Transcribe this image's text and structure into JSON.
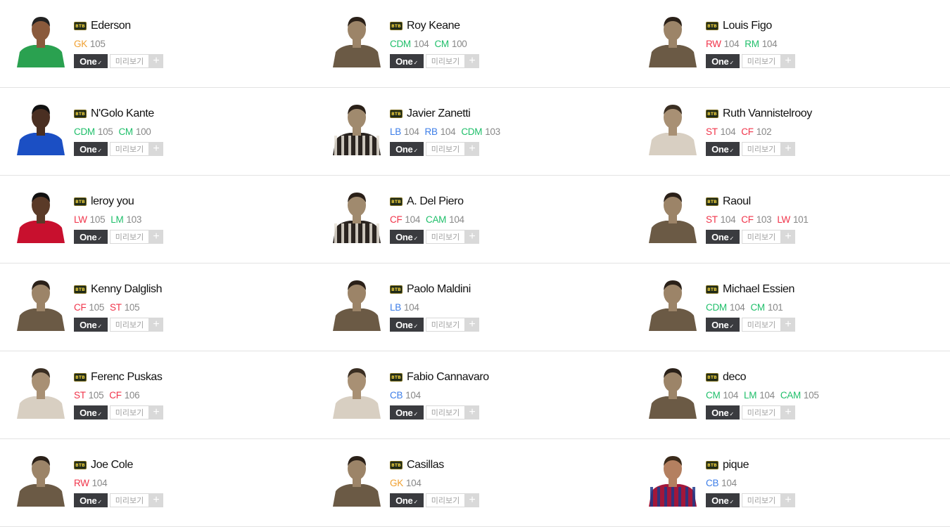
{
  "colors": {
    "GK": "#f0a030",
    "CDM": "#1fbf6a",
    "CM": "#1fbf6a",
    "LM": "#1fbf6a",
    "RM": "#1fbf6a",
    "CAM": "#1fbf6a",
    "RW": "#f0344a",
    "LW": "#f0344a",
    "ST": "#f0344a",
    "CF": "#f0344a",
    "LB": "#3d7ee8",
    "RB": "#3d7ee8",
    "CB": "#3d7ee8"
  },
  "labels": {
    "one": "One",
    "preview": "미리보기",
    "plus": "+"
  },
  "season_badge": "BTB",
  "players": [
    {
      "name": "Ederson",
      "photo": "green-kit",
      "positions": [
        {
          "pos": "GK",
          "ovr": "105"
        }
      ]
    },
    {
      "name": "Roy Keane",
      "photo": "sepia",
      "positions": [
        {
          "pos": "CDM",
          "ovr": "104"
        },
        {
          "pos": "CM",
          "ovr": "100"
        }
      ]
    },
    {
      "name": "Louis Figo",
      "photo": "sepia",
      "positions": [
        {
          "pos": "RW",
          "ovr": "104"
        },
        {
          "pos": "RM",
          "ovr": "104"
        }
      ]
    },
    {
      "name": "N'Golo Kante",
      "photo": "blue-kit",
      "positions": [
        {
          "pos": "CDM",
          "ovr": "105"
        },
        {
          "pos": "CM",
          "ovr": "100"
        }
      ]
    },
    {
      "name": "Javier Zanetti",
      "photo": "sepia-stripes",
      "positions": [
        {
          "pos": "LB",
          "ovr": "104"
        },
        {
          "pos": "RB",
          "ovr": "104"
        },
        {
          "pos": "CDM",
          "ovr": "103"
        }
      ]
    },
    {
      "name": "Ruth Vannistelrooy",
      "photo": "sepia-light",
      "positions": [
        {
          "pos": "ST",
          "ovr": "104"
        },
        {
          "pos": "CF",
          "ovr": "102"
        }
      ]
    },
    {
      "name": "leroy you",
      "photo": "red-kit",
      "positions": [
        {
          "pos": "LW",
          "ovr": "105"
        },
        {
          "pos": "LM",
          "ovr": "103"
        }
      ]
    },
    {
      "name": "A. Del Piero",
      "photo": "sepia-stripes",
      "positions": [
        {
          "pos": "CF",
          "ovr": "104"
        },
        {
          "pos": "CAM",
          "ovr": "104"
        }
      ]
    },
    {
      "name": "Raoul",
      "photo": "sepia",
      "positions": [
        {
          "pos": "ST",
          "ovr": "104"
        },
        {
          "pos": "CF",
          "ovr": "103"
        },
        {
          "pos": "LW",
          "ovr": "101"
        }
      ]
    },
    {
      "name": "Kenny Dalglish",
      "photo": "sepia",
      "positions": [
        {
          "pos": "CF",
          "ovr": "105"
        },
        {
          "pos": "ST",
          "ovr": "105"
        }
      ]
    },
    {
      "name": "Paolo Maldini",
      "photo": "sepia",
      "positions": [
        {
          "pos": "LB",
          "ovr": "104"
        }
      ]
    },
    {
      "name": "Michael Essien",
      "photo": "sepia",
      "positions": [
        {
          "pos": "CDM",
          "ovr": "104"
        },
        {
          "pos": "CM",
          "ovr": "101"
        }
      ]
    },
    {
      "name": "Ferenc Puskas",
      "photo": "sepia-light",
      "positions": [
        {
          "pos": "ST",
          "ovr": "105"
        },
        {
          "pos": "CF",
          "ovr": "106"
        }
      ]
    },
    {
      "name": "Fabio Cannavaro",
      "photo": "sepia-light",
      "positions": [
        {
          "pos": "CB",
          "ovr": "104"
        }
      ]
    },
    {
      "name": "deco",
      "photo": "sepia",
      "positions": [
        {
          "pos": "CM",
          "ovr": "104"
        },
        {
          "pos": "LM",
          "ovr": "104"
        },
        {
          "pos": "CAM",
          "ovr": "105"
        }
      ]
    },
    {
      "name": "Joe Cole",
      "photo": "sepia",
      "positions": [
        {
          "pos": "RW",
          "ovr": "104"
        }
      ]
    },
    {
      "name": "Casillas",
      "photo": "sepia",
      "positions": [
        {
          "pos": "GK",
          "ovr": "104"
        }
      ]
    },
    {
      "name": "pique",
      "photo": "barca-kit",
      "positions": [
        {
          "pos": "CB",
          "ovr": "104"
        }
      ]
    }
  ]
}
